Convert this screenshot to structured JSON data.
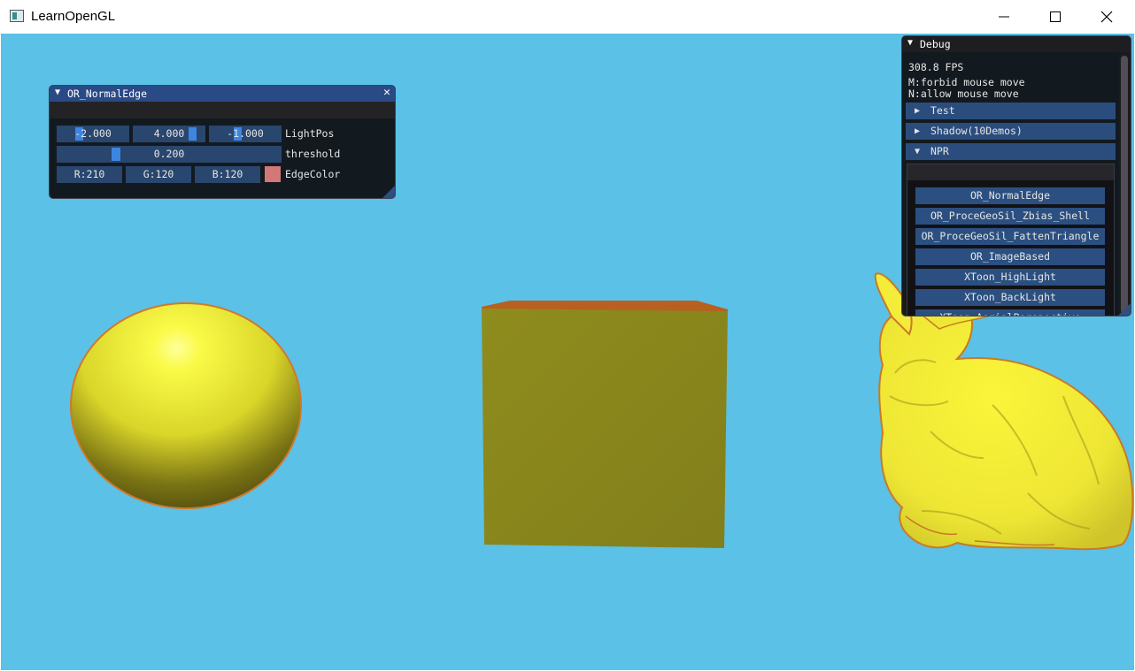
{
  "window": {
    "title": "LearnOpenGL"
  },
  "normal_edge_panel": {
    "title": "OR_NormalEdge",
    "light_pos": {
      "x": "-2.000",
      "y": "4.000",
      "z": "-1.000",
      "label": "LightPos"
    },
    "threshold": {
      "value": "0.200",
      "label": "threshold"
    },
    "edge_color": {
      "r": "R:210",
      "g": "G:120",
      "b": "B:120",
      "label": "EdgeColor",
      "swatch": "#d27878"
    }
  },
  "debug_panel": {
    "title": "Debug",
    "fps": "308.8 FPS",
    "help_m": "M:forbid mouse move",
    "help_n": "N:allow mouse move",
    "sections": [
      {
        "label": "Test",
        "arrow": "▶"
      },
      {
        "label": "Shadow(10Demos)",
        "arrow": "▶"
      },
      {
        "label": "NPR",
        "arrow": "▼"
      }
    ],
    "npr_buttons": [
      "OR_NormalEdge",
      "OR_ProceGeoSil_Zbias_Shell",
      "OR_ProceGeoSil_FattenTriangle",
      "OR_ImageBased",
      "XToon_HighLight",
      "XToon_BackLight",
      "XToon_AerialPerspective"
    ]
  },
  "colors": {
    "background": "#5bc1e6",
    "object_yellow": "#f2ef3e",
    "edge": "#d27828",
    "cube": "#8c8c1e"
  }
}
